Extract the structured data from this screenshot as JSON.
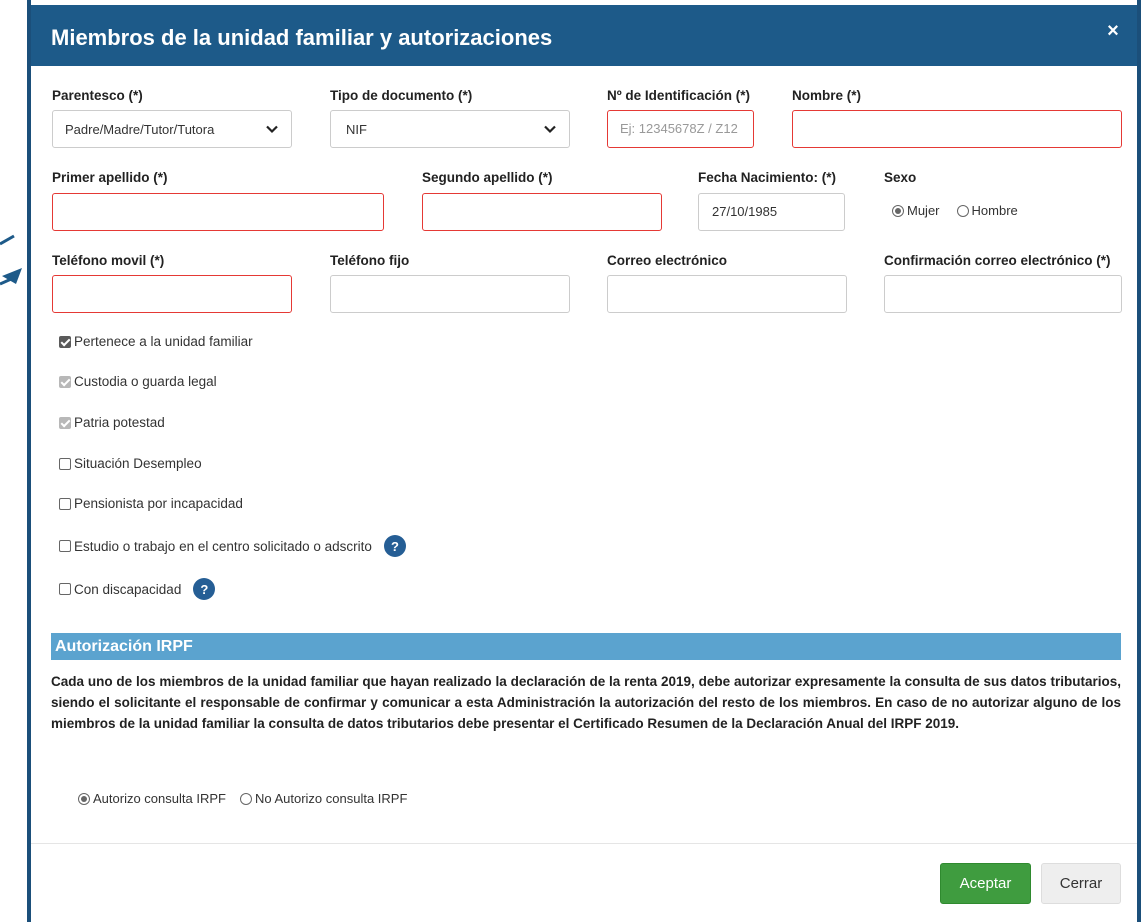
{
  "dialog": {
    "title": "Miembros de la unidad familiar y autorizaciones",
    "close_symbol": "×"
  },
  "row1": {
    "parentesco": {
      "label": "Parentesco (*)",
      "value": "Padre/Madre/Tutor/Tutora"
    },
    "tipo_documento": {
      "label": "Tipo de documento (*)",
      "value": "NIF"
    },
    "identificacion": {
      "label": "Nº de Identificación (*)",
      "placeholder": "Ej: 12345678Z / Z12"
    },
    "nombre": {
      "label": "Nombre (*)",
      "value": ""
    }
  },
  "row2": {
    "primer_apellido": {
      "label": "Primer apellido (*)",
      "value": ""
    },
    "segundo_apellido": {
      "label": "Segundo apellido (*)",
      "value": ""
    },
    "fecha_nacimiento": {
      "label": "Fecha Nacimiento: (*)",
      "value": "27/10/1985"
    },
    "sexo": {
      "label": "Sexo",
      "options": [
        "Mujer",
        "Hombre"
      ],
      "selected": "Mujer"
    }
  },
  "row3": {
    "telefono_movil": {
      "label": "Teléfono movil (*)",
      "value": ""
    },
    "telefono_fijo": {
      "label": "Teléfono fijo",
      "value": ""
    },
    "correo": {
      "label": "Correo electrónico",
      "value": ""
    },
    "confirmacion_correo": {
      "label": "Confirmación correo electrónico (*)",
      "value": ""
    }
  },
  "checkboxes": [
    {
      "label": "Pertenece a la unidad familiar",
      "state": "checked"
    },
    {
      "label": "Custodia o guarda legal",
      "state": "checked-disabled"
    },
    {
      "label": "Patria potestad",
      "state": "checked-disabled"
    },
    {
      "label": "Situación Desempleo",
      "state": "unchecked"
    },
    {
      "label": "Pensionista por incapacidad",
      "state": "unchecked"
    },
    {
      "label": "Estudio o trabajo en el centro solicitado o adscrito",
      "state": "unchecked",
      "help": "?"
    },
    {
      "label": "Con discapacidad",
      "state": "unchecked",
      "help": "?"
    }
  ],
  "irpf": {
    "section_title": "Autorización IRPF",
    "text": "Cada uno de los miembros de la unidad familiar que hayan realizado la declaración de la renta 2019, debe autorizar expresamente la consulta de sus datos tributarios, siendo el solicitante el responsable de confirmar y comunicar a esta Administración la autorización del resto de los miembros. En caso de no autorizar alguno de los miembros de la unidad familiar la consulta de datos tributarios debe presentar el Certificado Resumen de la Declaración Anual del IRPF 2019.",
    "options": [
      "Autorizo consulta IRPF",
      "No Autorizo consulta IRPF"
    ],
    "selected": "Autorizo consulta IRPF"
  },
  "footer": {
    "accept_label": "Aceptar",
    "close_label": "Cerrar"
  },
  "colors": {
    "header": "#1d5a89",
    "section": "#5ba3cf",
    "accept": "#3f9c3f",
    "required_border": "#e53935",
    "help": "#255e95"
  }
}
